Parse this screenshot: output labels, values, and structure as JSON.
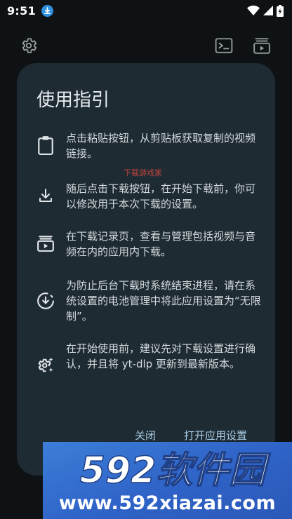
{
  "status_bar": {
    "time": "9:51",
    "icons": [
      "download-badge-icon",
      "wifi-icon",
      "signal-icon",
      "battery-icon"
    ]
  },
  "toolbar": {
    "icons": [
      "settings-icon",
      "terminal-icon",
      "download-queue-icon"
    ]
  },
  "dialog": {
    "title": "使用指引",
    "items": [
      {
        "icon": "clipboard-icon",
        "text": "点击粘贴按钮，从剪贴板获取复制的视频链接。"
      },
      {
        "icon": "download-icon",
        "text": "随后点击下载按钮，在开始下载前，你可以修改用于本次下载的设置。"
      },
      {
        "icon": "subscriptions-icon",
        "text": "在下载记录页，查看与管理包括视频与音频在内的应用内下载。"
      },
      {
        "icon": "download-progress-icon",
        "text": "为防止后台下载时系统结束进程，请在系统设置的电池管理中将此应用设置为“无限制”。"
      },
      {
        "icon": "settings-sparkle-icon",
        "text": "在开始使用前，建议先对下载设置进行确认，并且将 yt-dlp 更新到最新版本。"
      }
    ],
    "actions": {
      "dismiss": "关闭",
      "open_settings": "打开应用设置"
    }
  },
  "watermark": {
    "mid_text": "下载游戏家",
    "banner_logo": "592软件园",
    "banner_url": "www.592xiazai.com"
  },
  "colors": {
    "background": "#0f1214",
    "dialog": "#1e2b33",
    "accent_text": "#a9cde6",
    "banner": "#3c7ed8"
  }
}
